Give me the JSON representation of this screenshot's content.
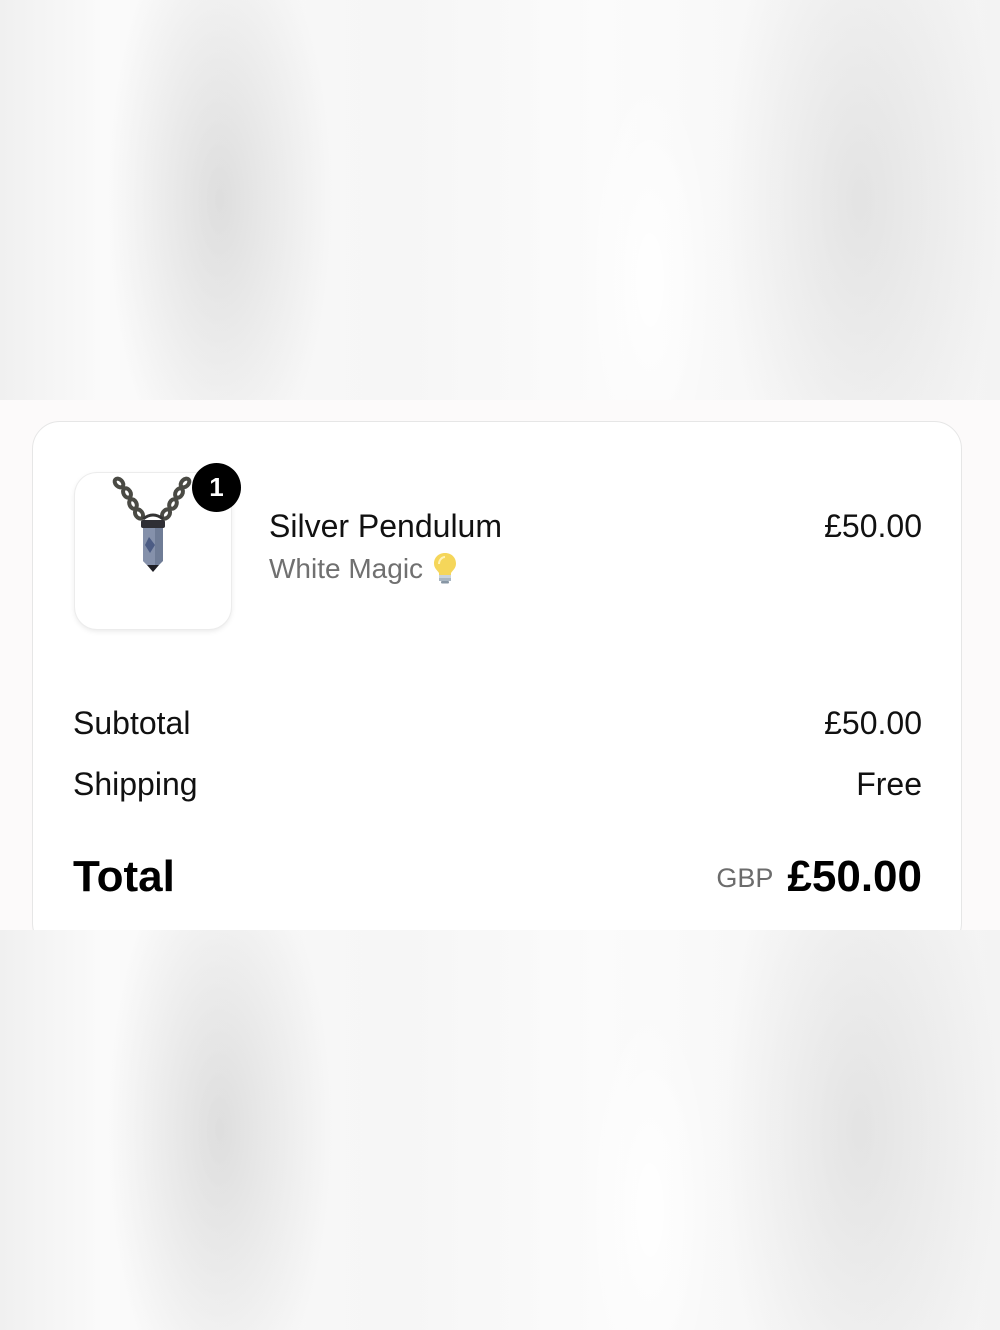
{
  "order_summary": {
    "item": {
      "name": "Silver Pendulum",
      "variant": "White Magic",
      "variant_icon": "lightbulb-icon",
      "price": "£50.00",
      "quantity": "1",
      "image_icon": "pendulum-necklace-image"
    },
    "subtotal": {
      "label": "Subtotal",
      "value": "£50.00"
    },
    "shipping": {
      "label": "Shipping",
      "value": "Free"
    },
    "total": {
      "label": "Total",
      "currency": "GBP",
      "value": "£50.00"
    }
  },
  "colors": {
    "text": "#111111",
    "muted": "#707070",
    "badge_bg": "#000000",
    "card_bg": "#ffffff"
  }
}
